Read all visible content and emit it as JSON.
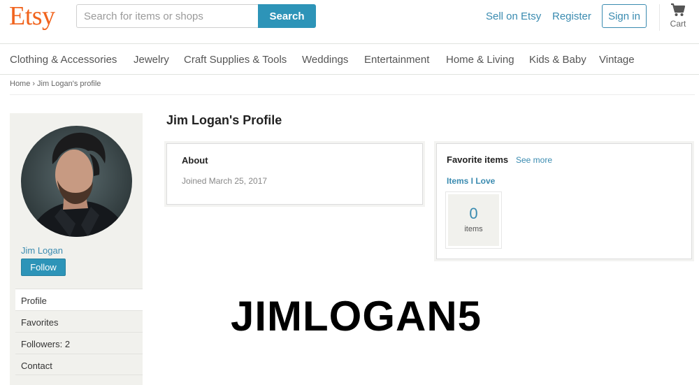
{
  "header": {
    "logo": "Etsy",
    "search_placeholder": "Search for items or shops",
    "search_button": "Search",
    "sell_link": "Sell on Etsy",
    "register_link": "Register",
    "signin_button": "Sign in",
    "cart_label": "Cart"
  },
  "categories": [
    "Clothing & Accessories",
    "Jewelry",
    "Craft Supplies & Tools",
    "Weddings",
    "Entertainment",
    "Home & Living",
    "Kids & Baby",
    "Vintage"
  ],
  "breadcrumb": {
    "home": "Home",
    "separator": "›",
    "current": "Jim Logan's profile"
  },
  "sidebar": {
    "name": "Jim Logan",
    "follow_button": "Follow",
    "nav": [
      "Profile",
      "Favorites",
      "Followers: 2",
      "Contact"
    ]
  },
  "main": {
    "title": "Jim Logan's Profile",
    "about": {
      "title": "About",
      "joined": "Joined March 25, 2017"
    },
    "favorites": {
      "title": "Favorite items",
      "see_more": "See more",
      "list_name": "Items I Love",
      "count": "0",
      "count_label": "items"
    }
  },
  "overlay_text": "JIMLOGAN5",
  "colors": {
    "brand_orange": "#f1641e",
    "accent_blue": "#2d94b8",
    "link_blue": "#3a8bb0",
    "sidebar_bg": "#f1f1ed"
  }
}
